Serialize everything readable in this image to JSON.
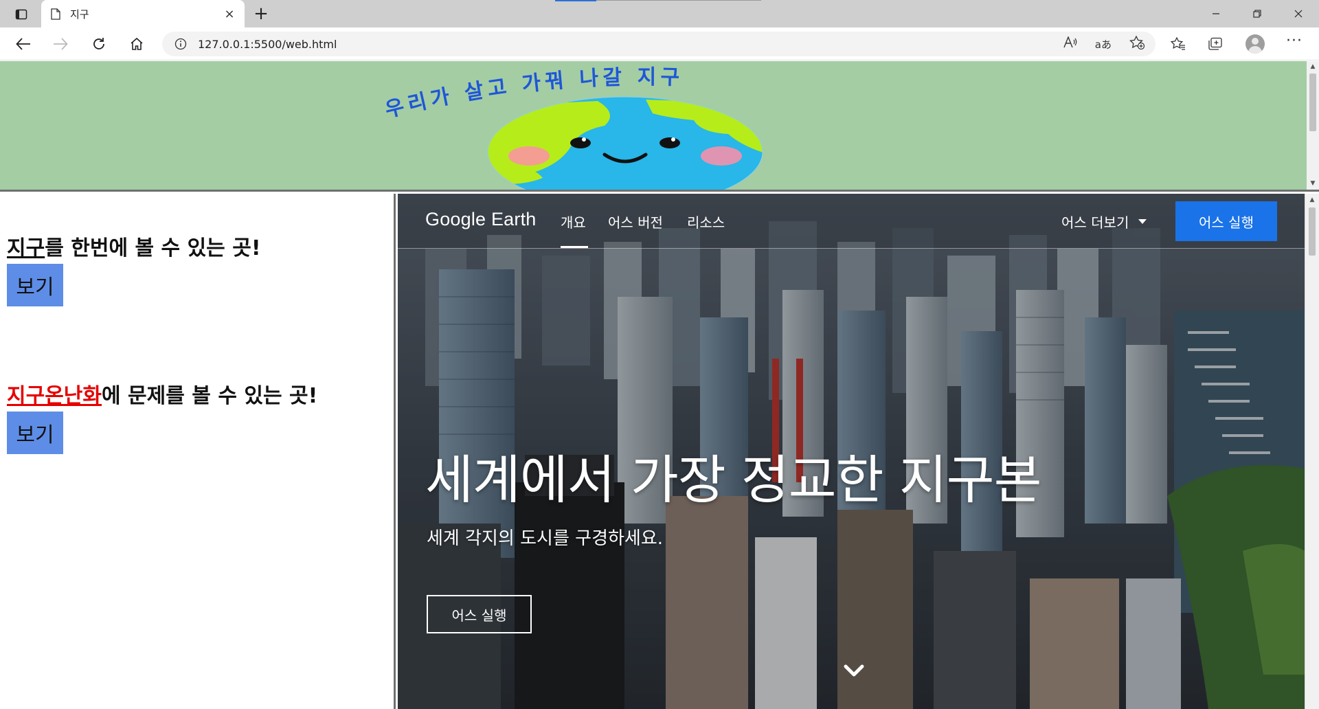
{
  "browser": {
    "tab_title": "지구",
    "new_tab": "+",
    "close_tab": "×",
    "address_url": "127.0.0.1:5500/web.html",
    "read_aloud": "A̅",
    "translate": "aあ"
  },
  "banner": {
    "arc_text": "우리가 살고 가꿔 나갈 지구",
    "colors": {
      "background": "#a4cda4",
      "ocean": "#29b6e8",
      "land": "#b6ec1a"
    }
  },
  "left_panel": {
    "section1": {
      "highlight": "지구",
      "rest": "를 한번에 볼 수 있는 곳!",
      "button": "보기"
    },
    "section2": {
      "highlight": "지구온난화",
      "rest": "에 문제를 볼 수 있는 곳!",
      "button": "보기"
    }
  },
  "google_earth": {
    "logo": "Google Earth",
    "nav": [
      "개요",
      "어스 버전",
      "리소스"
    ],
    "more": "어스 더보기",
    "launch_button": "어스 실행",
    "title": "세계에서 가장 정교한 지구본",
    "subtitle": "세계 각지의 도시를 구경하세요.",
    "cta_button": "어스 실행",
    "colors": {
      "accent": "#1a73e8"
    }
  }
}
